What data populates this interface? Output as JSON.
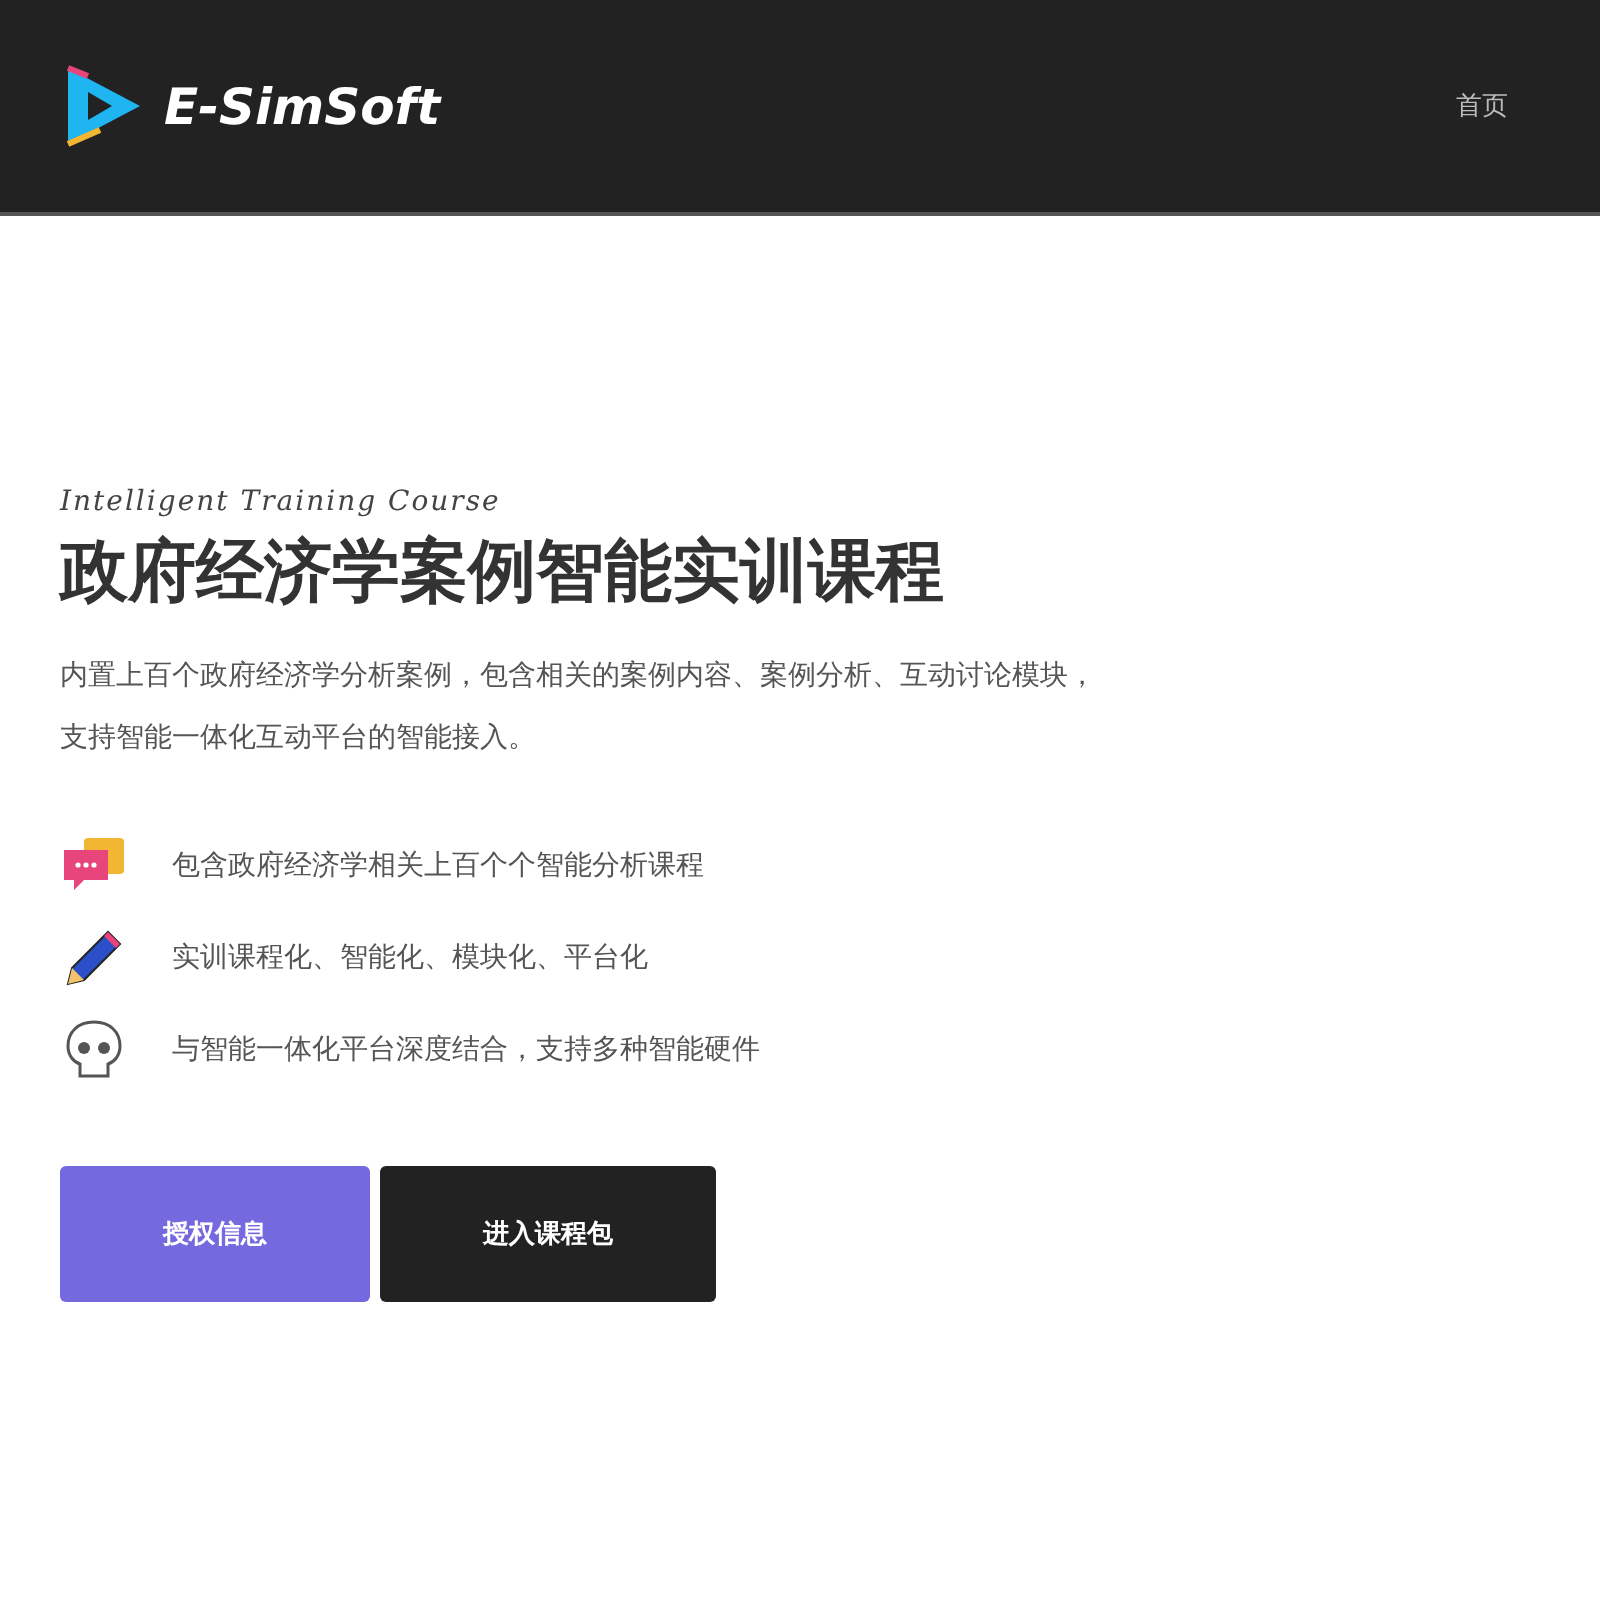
{
  "header": {
    "logo_text": "E-SimSoft",
    "nav": [
      {
        "label": "首页"
      }
    ]
  },
  "hero": {
    "eyebrow": "Intelligent Training Course",
    "title": "政府经济学案例智能实训课程",
    "description": [
      "内置上百个政府经济学分析案例，包含相关的案例内容、案例分析、互动讨论模块，",
      "支持智能一体化互动平台的智能接入。"
    ],
    "features": [
      {
        "kind": "chat",
        "text": "包含政府经济学相关上百个个智能分析课程"
      },
      {
        "kind": "pencil",
        "text": "实训课程化、智能化、模块化、平台化"
      },
      {
        "kind": "skull",
        "text": "与智能一体化平台深度结合，支持多种智能硬件"
      }
    ],
    "buttons": [
      {
        "kind": "primary",
        "label": "授权信息"
      },
      {
        "kind": "dark",
        "label": "进入课程包"
      }
    ]
  }
}
